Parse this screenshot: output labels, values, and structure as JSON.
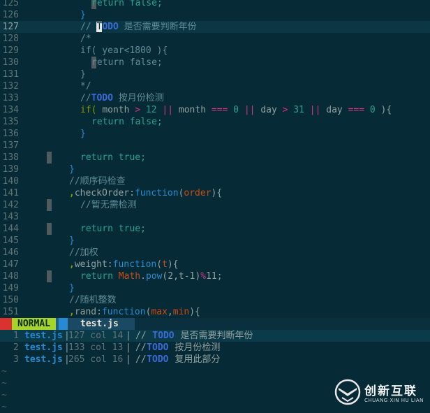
{
  "colors": {
    "background": "#062b36",
    "line_number": "#5f7479",
    "comment": "#5f8c97",
    "keyword": "#859900",
    "string": "#2aa198",
    "number": "#2aa198",
    "function": "#268bd2",
    "todo": "#3b6bd6",
    "object": "#cb4b16",
    "operator": "#d33682",
    "normal_mode": "#a7d42a"
  },
  "editor": {
    "lines": [
      {
        "n": "125",
        "indent": 4,
        "guides": [
          2
        ],
        "cur": false,
        "tokens": [
          {
            "t": "return false;",
            "c": "string"
          }
        ]
      },
      {
        "n": "126",
        "indent": 3,
        "guides": [],
        "cur": false,
        "tokens": [
          {
            "t": "}",
            "c": "function"
          }
        ]
      },
      {
        "n": "127",
        "indent": 3,
        "guides": [],
        "cur": true,
        "tokens": [
          {
            "t": "// ",
            "c": "comment"
          },
          {
            "t": "T",
            "c": "cursor"
          },
          {
            "t": "ODO",
            "c": "todo"
          },
          {
            "t": " 是否需要判断年份",
            "c": "comment"
          }
        ]
      },
      {
        "n": "128",
        "indent": 3,
        "guides": [],
        "cur": false,
        "tokens": [
          {
            "t": "/*",
            "c": "comment"
          }
        ]
      },
      {
        "n": "129",
        "indent": 3,
        "guides": [],
        "cur": false,
        "tokens": [
          {
            "t": "if( year<1800 ){",
            "c": "comment"
          }
        ]
      },
      {
        "n": "130",
        "indent": 4,
        "guides": [
          2
        ],
        "cur": false,
        "tokens": [
          {
            "t": "return false;",
            "c": "comment"
          }
        ]
      },
      {
        "n": "131",
        "indent": 3,
        "guides": [],
        "cur": false,
        "tokens": [
          {
            "t": "}",
            "c": "comment"
          }
        ]
      },
      {
        "n": "132",
        "indent": 3,
        "guides": [],
        "cur": false,
        "tokens": [
          {
            "t": "*/",
            "c": "comment"
          }
        ]
      },
      {
        "n": "133",
        "indent": 3,
        "guides": [],
        "cur": false,
        "tokens": [
          {
            "t": "//",
            "c": "comment"
          },
          {
            "t": "TODO",
            "c": "todo"
          },
          {
            "t": " 按月份检测",
            "c": "comment"
          }
        ]
      },
      {
        "n": "134",
        "indent": 3,
        "guides": [],
        "cur": false,
        "tokens": [
          {
            "t": "if( ",
            "c": "keyword"
          },
          {
            "t": "month ",
            "c": "plain"
          },
          {
            "t": ">",
            "c": "operator"
          },
          {
            "t": " 12 ",
            "c": "number"
          },
          {
            "t": "||",
            "c": "operator"
          },
          {
            "t": " month ",
            "c": "plain"
          },
          {
            "t": "===",
            "c": "operator"
          },
          {
            "t": " 0 ",
            "c": "number"
          },
          {
            "t": "||",
            "c": "operator"
          },
          {
            "t": " day ",
            "c": "plain"
          },
          {
            "t": ">",
            "c": "operator"
          },
          {
            "t": " 31 ",
            "c": "number"
          },
          {
            "t": "||",
            "c": "operator"
          },
          {
            "t": " day ",
            "c": "plain"
          },
          {
            "t": "===",
            "c": "operator"
          },
          {
            "t": " 0 ",
            "c": "number"
          },
          {
            "t": "){",
            "c": "plain"
          }
        ]
      },
      {
        "n": "135",
        "indent": 4,
        "guides": [],
        "cur": false,
        "tokens": [
          {
            "t": "return false;",
            "c": "string"
          }
        ]
      },
      {
        "n": "136",
        "indent": 3,
        "guides": [],
        "cur": false,
        "tokens": [
          {
            "t": "}",
            "c": "function"
          }
        ]
      },
      {
        "n": "137",
        "indent": 0,
        "guides": [],
        "cur": false,
        "tokens": []
      },
      {
        "n": "138",
        "indent": 3,
        "guides": [
          1
        ],
        "cur": false,
        "tokens": [
          {
            "t": "return true;",
            "c": "string"
          }
        ]
      },
      {
        "n": "139",
        "indent": 2,
        "guides": [],
        "cur": false,
        "tokens": [
          {
            "t": "}",
            "c": "function"
          }
        ]
      },
      {
        "n": "140",
        "indent": 2,
        "guides": [],
        "cur": false,
        "tokens": [
          {
            "t": "//顺序码检查",
            "c": "comment"
          }
        ]
      },
      {
        "n": "141",
        "indent": 2,
        "guides": [],
        "cur": false,
        "tokens": [
          {
            "t": ",",
            "c": "keyword"
          },
          {
            "t": "checkOrder",
            "c": "plain"
          },
          {
            "t": ":",
            "c": "plain"
          },
          {
            "t": "function",
            "c": "function"
          },
          {
            "t": "(",
            "c": "plain"
          },
          {
            "t": "order",
            "c": "object"
          },
          {
            "t": "){",
            "c": "plain"
          }
        ]
      },
      {
        "n": "142",
        "indent": 3,
        "guides": [
          1
        ],
        "cur": false,
        "tokens": [
          {
            "t": "//暂无需检测",
            "c": "comment"
          }
        ]
      },
      {
        "n": "143",
        "indent": 0,
        "guides": [],
        "cur": false,
        "tokens": []
      },
      {
        "n": "144",
        "indent": 3,
        "guides": [
          1
        ],
        "cur": false,
        "tokens": [
          {
            "t": "return true;",
            "c": "string"
          }
        ]
      },
      {
        "n": "145",
        "indent": 2,
        "guides": [],
        "cur": false,
        "tokens": [
          {
            "t": "}",
            "c": "function"
          }
        ]
      },
      {
        "n": "146",
        "indent": 2,
        "guides": [],
        "cur": false,
        "tokens": [
          {
            "t": "//加权",
            "c": "comment"
          }
        ]
      },
      {
        "n": "147",
        "indent": 2,
        "guides": [],
        "cur": false,
        "tokens": [
          {
            "t": ",",
            "c": "keyword"
          },
          {
            "t": "weight",
            "c": "plain"
          },
          {
            "t": ":",
            "c": "plain"
          },
          {
            "t": "function",
            "c": "function"
          },
          {
            "t": "(",
            "c": "plain"
          },
          {
            "t": "t",
            "c": "object"
          },
          {
            "t": "){",
            "c": "plain"
          }
        ]
      },
      {
        "n": "148",
        "indent": 3,
        "guides": [
          1
        ],
        "cur": false,
        "tokens": [
          {
            "t": "return ",
            "c": "string"
          },
          {
            "t": "Math",
            "c": "object"
          },
          {
            "t": ".",
            "c": "plain"
          },
          {
            "t": "pow",
            "c": "function"
          },
          {
            "t": "(2,t-1)",
            "c": "plain"
          },
          {
            "t": "%",
            "c": "operator"
          },
          {
            "t": "11;",
            "c": "plain"
          }
        ]
      },
      {
        "n": "149",
        "indent": 2,
        "guides": [],
        "cur": false,
        "tokens": [
          {
            "t": "}",
            "c": "function"
          }
        ]
      },
      {
        "n": "150",
        "indent": 2,
        "guides": [],
        "cur": false,
        "tokens": [
          {
            "t": "//随机整数",
            "c": "comment"
          }
        ]
      },
      {
        "n": "151",
        "indent": 2,
        "guides": [],
        "cur": false,
        "tokens": [
          {
            "t": ",",
            "c": "keyword"
          },
          {
            "t": "rand",
            "c": "plain"
          },
          {
            "t": ":",
            "c": "plain"
          },
          {
            "t": "function",
            "c": "function"
          },
          {
            "t": "(",
            "c": "plain"
          },
          {
            "t": "max",
            "c": "object"
          },
          {
            "t": ",",
            "c": "plain"
          },
          {
            "t": "min",
            "c": "object"
          },
          {
            "t": "){",
            "c": "plain"
          }
        ]
      }
    ]
  },
  "statusbar": {
    "mode": "NORMAL",
    "filename": "test.js"
  },
  "quickfix": {
    "rows": [
      {
        "n": "1",
        "file": "test.js",
        "loc": "127 col 14",
        "pre": "// ",
        "todo": "TODO",
        "text": " 是否需要判断年份"
      },
      {
        "n": "2",
        "file": "test.js",
        "loc": "133 col 13",
        "pre": "//",
        "todo": "TODO",
        "text": " 按月份检测"
      },
      {
        "n": "3",
        "file": "test.js",
        "loc": "265 col 16",
        "pre": "//",
        "todo": "TODO",
        "text": " 复用此部分"
      }
    ],
    "tilde": "~"
  },
  "watermark": {
    "name": "创新互联",
    "sub": "CHUANG XIN HU LIAN"
  }
}
